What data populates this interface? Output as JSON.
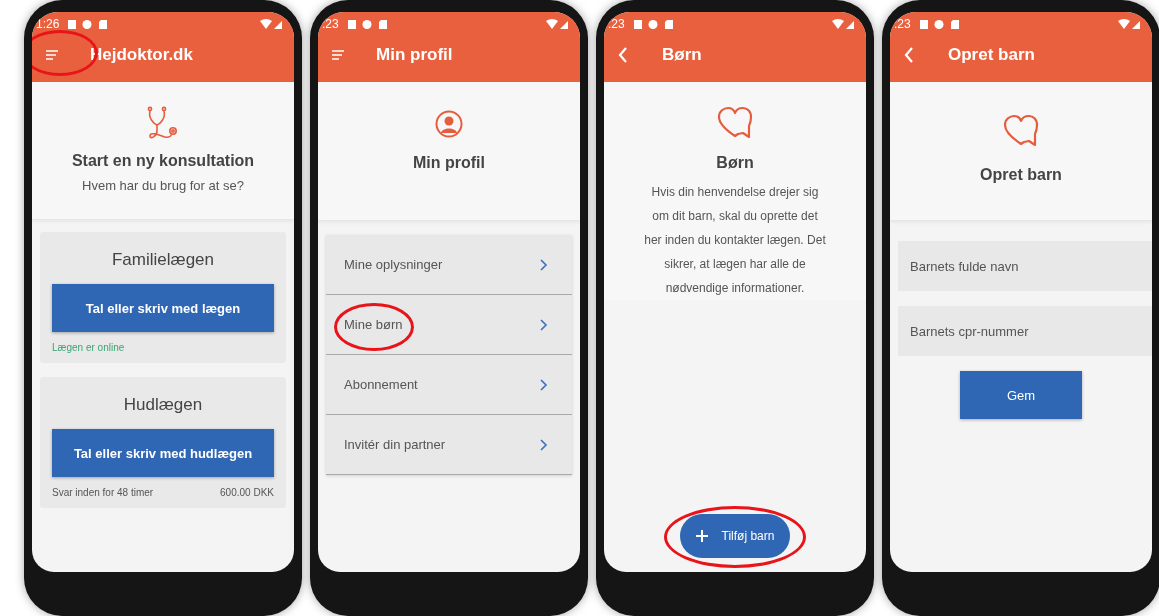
{
  "phones": [
    {
      "kind": "home",
      "status_time": "1:26",
      "header": {
        "title": "Hejdoktor.dk",
        "highlighted": true
      },
      "hero": {
        "title": "Start en ny konsultation",
        "subtitle": "Hvem har du brug for at se?"
      },
      "cards": [
        {
          "title": "Familielægen",
          "button": "Tal eller skriv med lægen",
          "note": "Lægen er online"
        },
        {
          "title": "Hudlægen",
          "button": "Tal eller skriv med hudlægen",
          "footer_left": "Svar inden for 48 timer",
          "footer_right": "600.00 DKK"
        }
      ]
    },
    {
      "kind": "profile",
      "status_time": ":23",
      "header": {
        "title": "Min profil"
      },
      "hero": {
        "title": "Min profil"
      },
      "items": [
        {
          "label": "Mine oplysninger",
          "highlighted": false
        },
        {
          "label": "Mine børn",
          "highlighted": true
        },
        {
          "label": "Abonnement",
          "highlighted": false
        },
        {
          "label": "Invitér din partner",
          "highlighted": false
        }
      ]
    },
    {
      "kind": "info",
      "status_time": ":23",
      "header": {
        "title": "Børn"
      },
      "hero": {
        "title": "Børn",
        "text": "Hvis din henvendelse drejer sig om dit barn, skal du oprette det her inden du kontakter lægen. Det sikrer, at lægen har alle de nødvendige informationer."
      },
      "fab": {
        "label": "Tilføj barn",
        "highlighted": true
      }
    },
    {
      "kind": "form",
      "status_time": ":23",
      "header": {
        "title": "Opret barn"
      },
      "hero": {
        "title": "Opret barn"
      },
      "fields": [
        {
          "placeholder": "Barnets fulde navn"
        },
        {
          "placeholder": "Barnets cpr-nummer"
        }
      ],
      "button": "Gem"
    }
  ]
}
